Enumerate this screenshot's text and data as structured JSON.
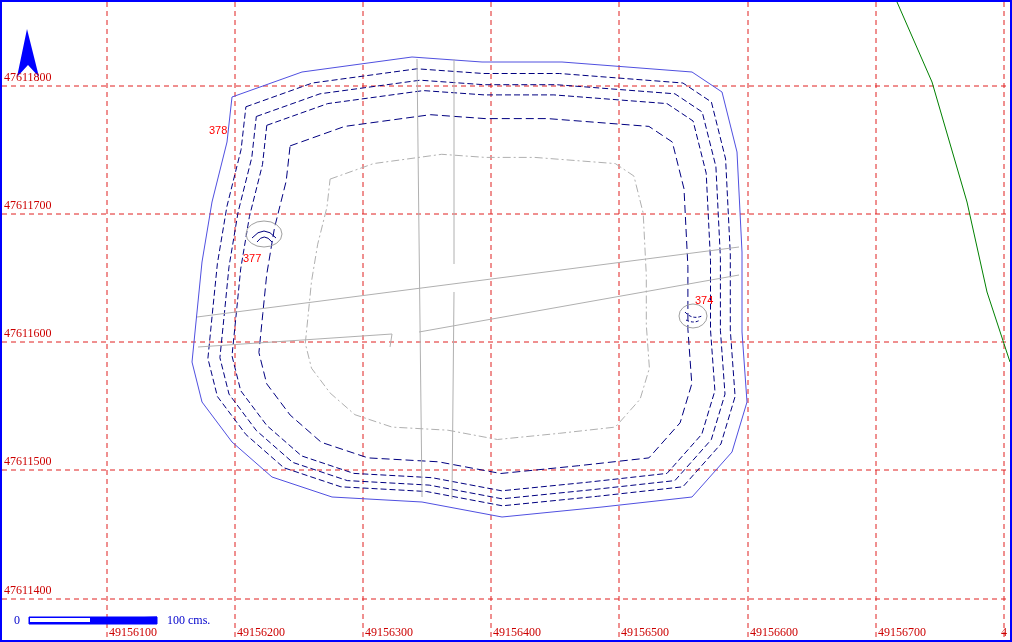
{
  "map": {
    "y_axis_labels": [
      "47611800",
      "47611700",
      "47611600",
      "47611500",
      "47611400"
    ],
    "x_axis_labels": [
      "49156100",
      "49156200",
      "49156300",
      "49156400",
      "49156500",
      "49156600",
      "49156700",
      "4"
    ],
    "contour_labels": [
      "378",
      "377",
      "374"
    ]
  },
  "scale_bar": {
    "start": "0",
    "end": "100 cms."
  }
}
